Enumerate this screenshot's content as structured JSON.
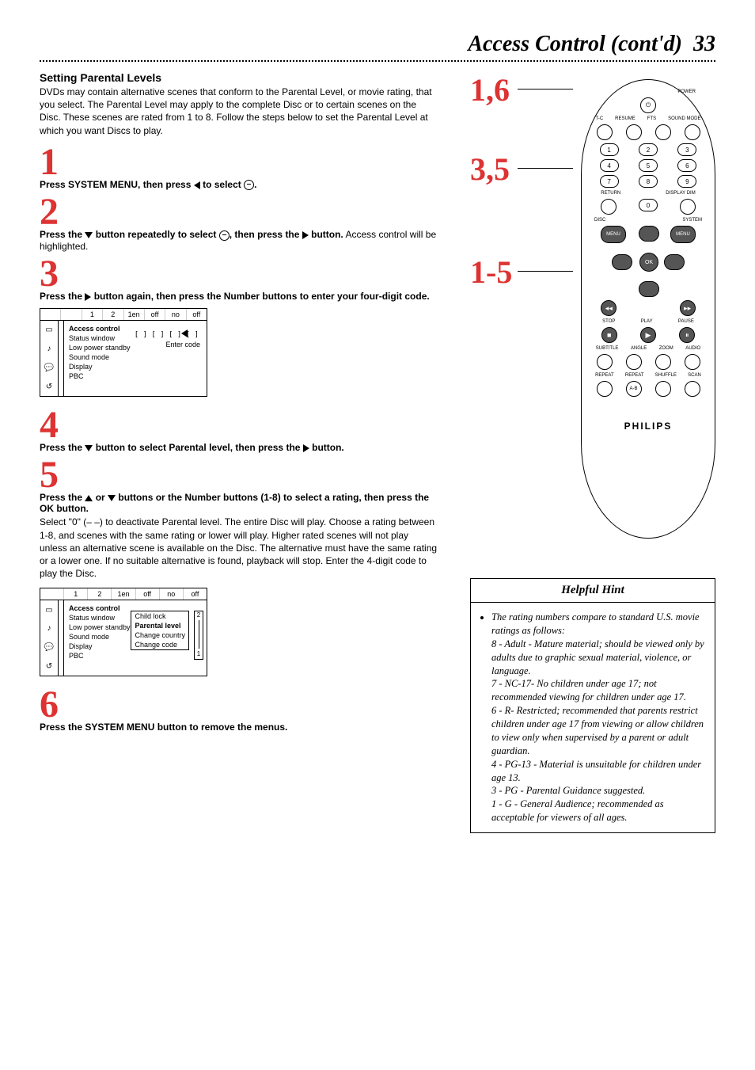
{
  "page": {
    "title": "Access Control (cont'd)",
    "number": "33"
  },
  "section": {
    "heading": "Setting Parental Levels",
    "intro": "DVDs may contain alternative scenes that conform to the Parental Level, or movie rating, that you select. The Parental Level may apply to the complete Disc or to certain scenes on the Disc. These scenes are rated from 1 to 8. Follow the steps below to set the Parental Level at which you want Discs to play."
  },
  "steps": {
    "s1": {
      "num": "1",
      "text_a": "Press SYSTEM MENU, then press ",
      "text_b": " to select ",
      "text_c": "."
    },
    "s2": {
      "num": "2",
      "text_a": "Press the ",
      "text_b": " button repeatedly to select ",
      "text_c": ", then press the ",
      "text_d": " button.",
      "extra": " Access control will be highlighted."
    },
    "s3": {
      "num": "3",
      "text_a": "Press the ",
      "text_b": " button again, then press the Number buttons to enter your four-digit code."
    },
    "s4": {
      "num": "4",
      "text_a": "Press the ",
      "text_b": " button to select Parental level, then press the ",
      "text_c": " button."
    },
    "s5": {
      "num": "5",
      "text_a": "Press the ",
      "text_b": " or ",
      "text_c": " buttons or the Number buttons (1-8) to select a rating, then press the OK button.",
      "extra": "Select \"0\" (– –) to deactivate Parental level. The entire Disc will play. Choose a rating between 1-8, and scenes with the same rating or lower will play. Higher rated scenes will not play unless an alternative scene is available on the Disc. The alternative must have the same rating or a lower one. If no suitable alternative is found, playback will stop. Enter the 4-digit code to play the Disc."
    },
    "s6": {
      "num": "6",
      "text": "Press the SYSTEM MENU button to remove the menus."
    }
  },
  "osd1": {
    "top": [
      "",
      "",
      "1",
      "2",
      "1en",
      "off",
      "no",
      "off"
    ],
    "items": [
      "Access control",
      "Status window",
      "Low power standby",
      "Sound mode",
      "Display",
      "PBC"
    ],
    "slots": "[ ] [ ] [ ] [ ]",
    "enter": "Enter code"
  },
  "osd2": {
    "top": [
      "",
      "1",
      "2",
      "1en",
      "off",
      "no",
      "off"
    ],
    "items": [
      "Access control",
      "Status window",
      "Low power standby",
      "Sound mode",
      "Display",
      "PBC"
    ],
    "sub": [
      "Child lock",
      "Parental level",
      "Change country",
      "Change code"
    ],
    "scale_top": "2",
    "scale_bot": "1"
  },
  "remote": {
    "power": "POWER",
    "row1_labels": [
      "T-C",
      "RESUME",
      "FTS",
      "SOUND MODE"
    ],
    "numpad": [
      "1",
      "2",
      "3",
      "4",
      "5",
      "6",
      "7",
      "8",
      "9",
      "0"
    ],
    "return": "RETURN",
    "display_dim": "DISPLAY DIM",
    "disc": "DISC",
    "system": "SYSTEM",
    "menu": "MENU",
    "ok": "OK",
    "stop": "STOP",
    "play": "PLAY",
    "pause": "PAUSE",
    "row_a": [
      "SUBTITLE",
      "ANGLE",
      "ZOOM",
      "AUDIO"
    ],
    "row_b": [
      "REPEAT",
      "REPEAT",
      "SHUFFLE",
      "SCAN"
    ],
    "ab": "A-B",
    "brand": "PHILIPS"
  },
  "callouts": {
    "a": "1,6",
    "b": "3,5",
    "c": "1-5"
  },
  "hint": {
    "title": "Helpful Hint",
    "lead": "The rating numbers compare to standard U.S. movie ratings as follows:",
    "r8": "8 - Adult - Mature material; should be viewed only by adults due to graphic sexual material, violence, or language.",
    "r7": "7 - NC-17- No children under age 17; not recommended viewing for children under age 17.",
    "r6": "6 - R- Restricted; recommended that parents restrict children under age 17 from viewing or allow children to view only when supervised by a parent or adult guardian.",
    "r4": "4 - PG-13 - Material is unsuitable for children under age 13.",
    "r3": "3 - PG - Parental Guidance suggested.",
    "r1": "1 - G - General Audience; recommended as acceptable for viewers of all ages."
  }
}
